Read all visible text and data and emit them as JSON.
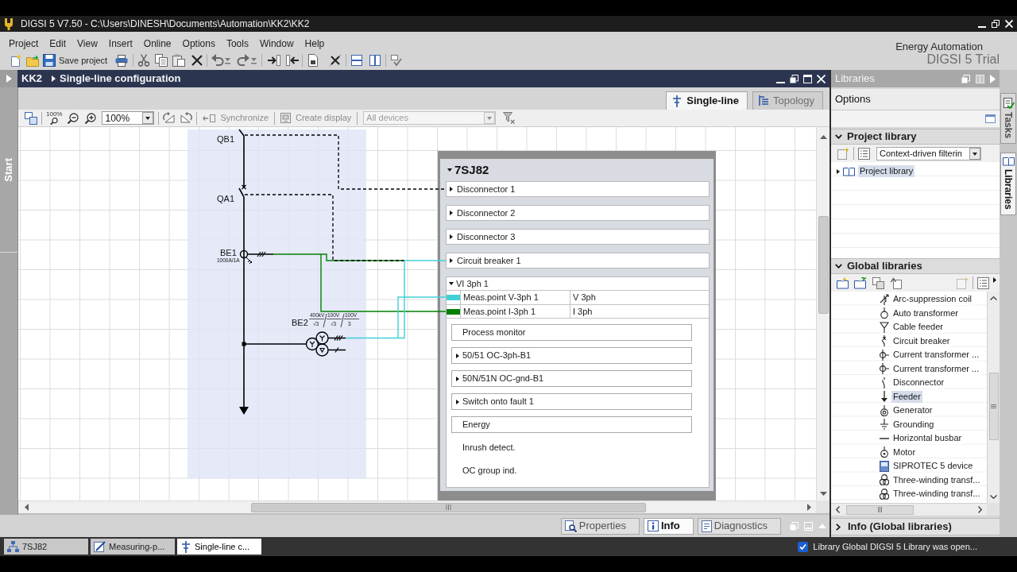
{
  "title_bar": {
    "title": "DIGSI 5 V7.50 - C:\\Users\\DINESH\\Documents\\Automation\\KK2\\KK2"
  },
  "menu": [
    "Project",
    "Edit",
    "View",
    "Insert",
    "Online",
    "Options",
    "Tools",
    "Window",
    "Help"
  ],
  "toolbar": {
    "save_label": "Save project"
  },
  "brand": {
    "company": "Energy Automation",
    "product": "DIGSI 5 Trial"
  },
  "side_tab": {
    "label": "Start"
  },
  "editor": {
    "breadcrumb": [
      "KK2",
      "Single-line configuration"
    ],
    "tabs": [
      {
        "label": "Single-line",
        "selected": true
      },
      {
        "label": "Topology",
        "selected": false
      }
    ],
    "toolbar": {
      "zoom_icon_text": "100%",
      "zoom_value": "100%",
      "actions": [
        {
          "label": "Synchronize",
          "disabled": true
        },
        {
          "label": "Create display",
          "disabled": true
        }
      ],
      "device_filter": {
        "value": "All devices",
        "disabled": true
      }
    }
  },
  "diagram": {
    "bay": [
      {
        "kind": "disconnector",
        "label": "QB1"
      },
      {
        "kind": "circuit_breaker",
        "label": "QA1"
      },
      {
        "kind": "current_transformer",
        "label": "BE1",
        "rating": "1000A/1A"
      },
      {
        "kind": "voltage_transformer",
        "label": "BE2",
        "ratio": [
          {
            "numerator": "400kV",
            "denominator": "√3"
          },
          {
            "numerator": "100V",
            "denominator": "√3"
          },
          {
            "numerator": "100V",
            "denominator": "3"
          }
        ]
      }
    ],
    "device": {
      "name": "7SJ82",
      "expanded": true,
      "items": [
        {
          "label": "Disconnector 1",
          "expanded": false
        },
        {
          "label": "Disconnector 2",
          "expanded": false
        },
        {
          "label": "Disconnector 3",
          "expanded": false
        },
        {
          "label": "Circuit breaker 1",
          "expanded": false
        }
      ],
      "function_group": {
        "label": "VI 3ph 1",
        "expanded": true,
        "measuring_points": [
          {
            "name": "Meas.point V-3ph 1",
            "type": "V 3ph",
            "color": "#40d0d8"
          },
          {
            "name": "Meas.point I-3ph 1",
            "type": "I 3ph",
            "color": "#008000"
          }
        ],
        "functions": [
          {
            "kind": "box",
            "label": "Process monitor"
          },
          {
            "kind": "folder",
            "label": "50/51 OC-3ph-B1",
            "expanded": false
          },
          {
            "kind": "folder",
            "label": "50N/51N OC-gnd-B1",
            "expanded": false
          },
          {
            "kind": "folder",
            "label": "Switch onto fault 1",
            "expanded": false
          },
          {
            "kind": "box",
            "label": "Energy"
          },
          {
            "kind": "text",
            "label": "Inrush detect."
          },
          {
            "kind": "text",
            "label": "OC group ind."
          }
        ]
      }
    }
  },
  "inspector_tabs": [
    {
      "label": "Properties",
      "selected": false
    },
    {
      "label": "Info",
      "selected": true
    },
    {
      "label": "Diagnostics",
      "selected": false
    }
  ],
  "libraries": {
    "title": "Libraries",
    "options_label": "Options",
    "project_library": {
      "title": "Project library",
      "expanded": true,
      "filter": "Context-driven filterin",
      "tree": [
        {
          "label": "Project library",
          "expanded": false,
          "selected": true
        }
      ]
    },
    "global_libraries": {
      "title": "Global libraries",
      "expanded": true,
      "items": [
        {
          "label": "Arc-suppression coil",
          "selected": false
        },
        {
          "label": "Auto transformer",
          "selected": false
        },
        {
          "label": "Cable feeder",
          "selected": false
        },
        {
          "label": "Circuit breaker",
          "selected": false
        },
        {
          "label": "Current transformer ...",
          "selected": false
        },
        {
          "label": "Current transformer ...",
          "selected": false
        },
        {
          "label": "Disconnector",
          "selected": false
        },
        {
          "label": "Feeder",
          "selected": true
        },
        {
          "label": "Generator",
          "selected": false
        },
        {
          "label": "Grounding",
          "selected": false
        },
        {
          "label": "Horizontal busbar",
          "selected": false
        },
        {
          "label": "Motor",
          "selected": false
        },
        {
          "label": "SIPROTEC 5 device",
          "selected": false
        },
        {
          "label": "Three-winding transf...",
          "selected": false
        },
        {
          "label": "Three-winding transf...",
          "selected": false
        }
      ]
    },
    "info": {
      "title": "Info (Global libraries)",
      "expanded": false
    }
  },
  "side_tabs": [
    {
      "label": "Tasks",
      "selected": false
    },
    {
      "label": "Libraries",
      "selected": true
    }
  ],
  "portal_tabs": [
    {
      "label": "7SJ82",
      "selected": false
    },
    {
      "label": "Measuring-p...",
      "selected": false
    },
    {
      "label": "Single-line c...",
      "selected": true
    }
  ],
  "status": {
    "message": "Library Global DIGSI 5 Library was open..."
  }
}
